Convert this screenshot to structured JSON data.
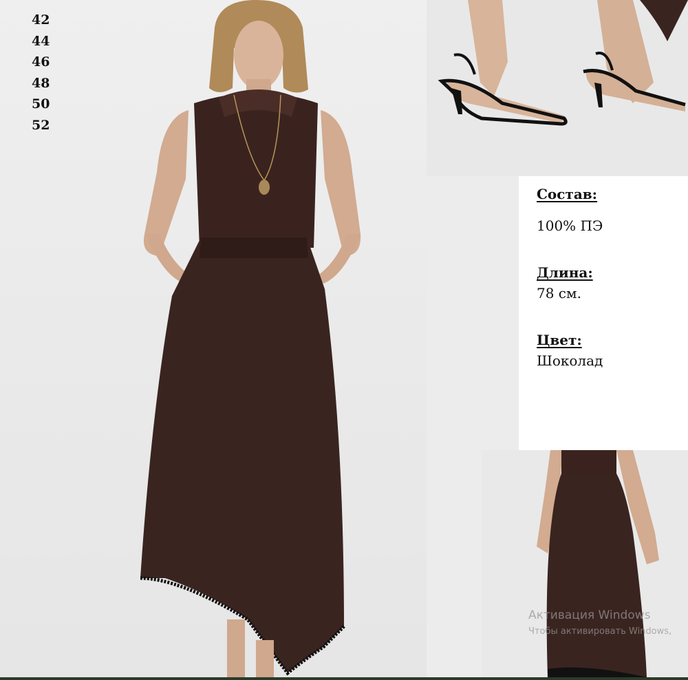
{
  "sizes": [
    "42",
    "44",
    "46",
    "48",
    "50",
    "52"
  ],
  "details": {
    "composition": {
      "label": "Состав:",
      "value": "100% ПЭ"
    },
    "length": {
      "label": "Длина:",
      "value": "78 см."
    },
    "color": {
      "label": "Цвет:",
      "value": "Шоколад"
    }
  },
  "watermark": {
    "title": "Активация Windows",
    "subtitle": "Чтобы активировать Windows,"
  },
  "colors": {
    "garment": "#3a2420",
    "background": "#ececec",
    "panel": "#ffffff"
  }
}
